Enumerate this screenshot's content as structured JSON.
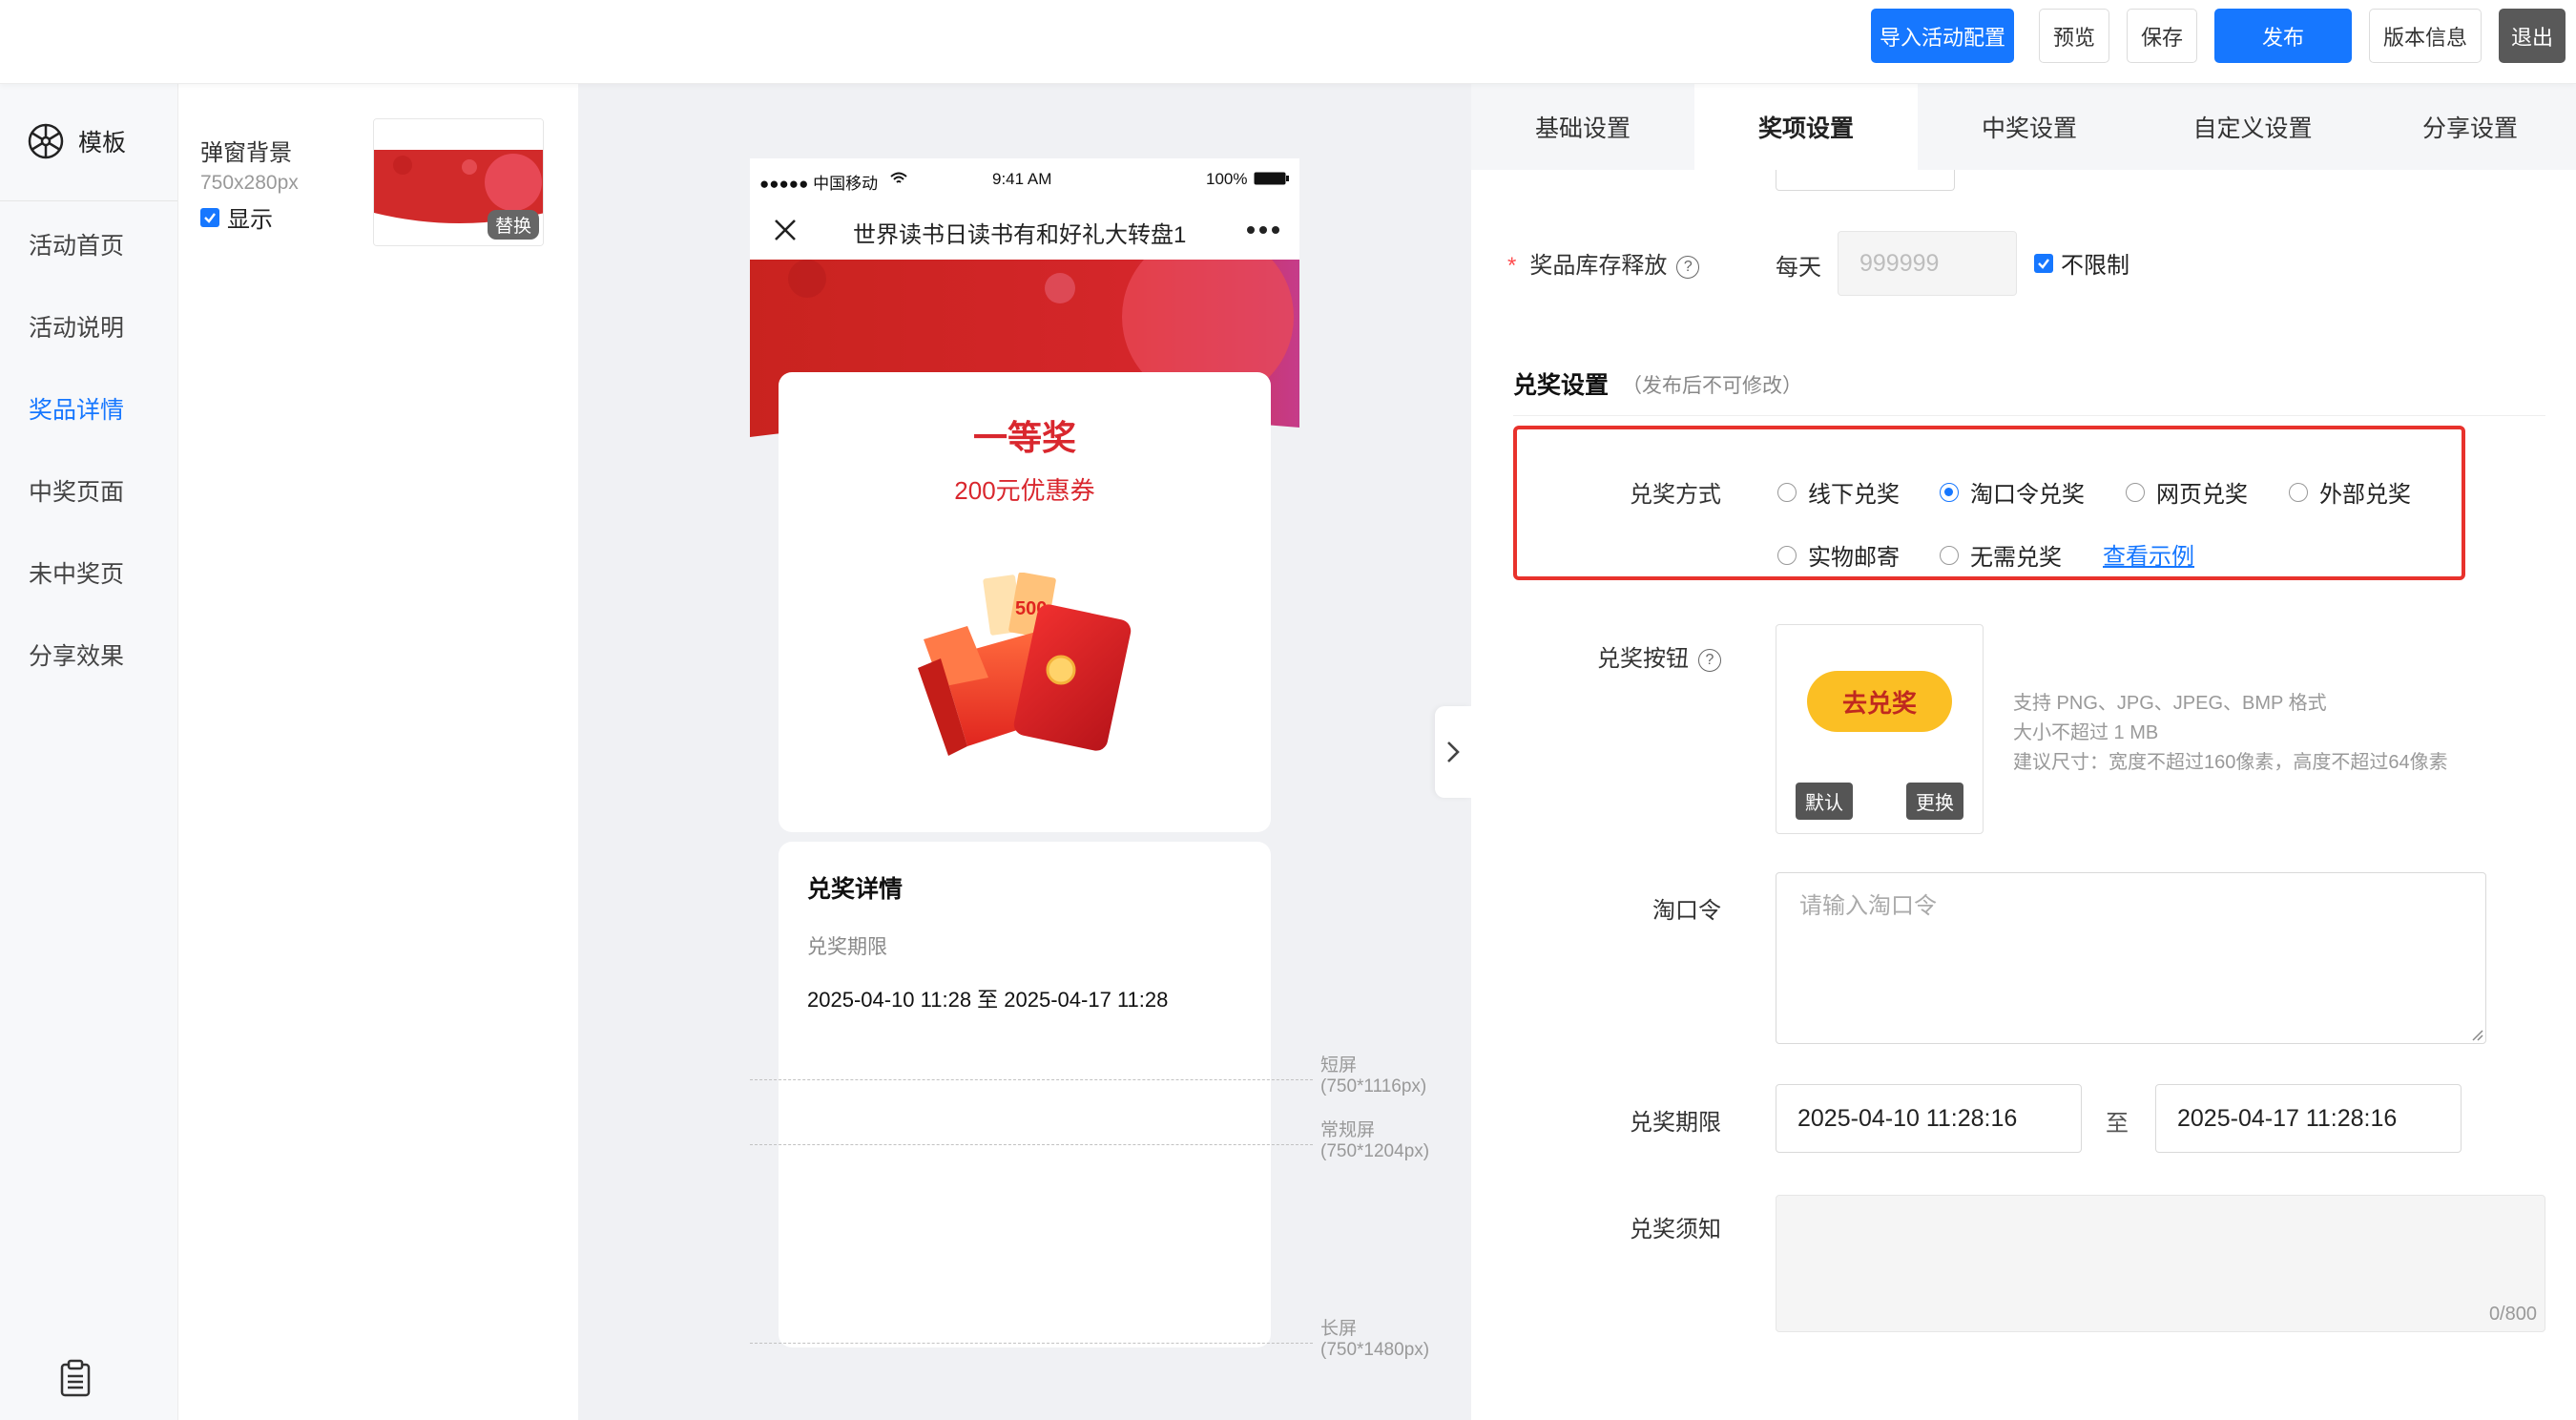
{
  "topbar": {
    "import_label": "导入活动配置",
    "preview_label": "预览",
    "save_label": "保存",
    "publish_label": "发布",
    "version_label": "版本信息",
    "exit_label": "退出"
  },
  "leftnav": {
    "logo_label": "模板",
    "items": [
      {
        "label": "活动首页",
        "active": false
      },
      {
        "label": "活动说明",
        "active": false
      },
      {
        "label": "奖品详情",
        "active": true
      },
      {
        "label": "中奖页面",
        "active": false
      },
      {
        "label": "未中奖页",
        "active": false
      },
      {
        "label": "分享效果",
        "active": false
      }
    ]
  },
  "module": {
    "bg_label": "弹窗背景",
    "bg_size": "750x280px",
    "show_label": "显示",
    "show_checked": true,
    "replace_label": "替换"
  },
  "phone": {
    "carrier": "●●●●● 中国移动",
    "time": "9:41 AM",
    "battery": "100%",
    "title": "世界读书日读书有和好礼大转盘1",
    "prize_name": "一等奖",
    "prize_desc": "200元优惠券",
    "coupon_text": "500",
    "detail_title": "兑奖详情",
    "detail_period_label": "兑奖期限",
    "detail_period_value": "2025-04-10 11:28 至 2025-04-17 11:28"
  },
  "guides": [
    {
      "name": "短屏",
      "size": "(750*1116px)"
    },
    {
      "name": "常规屏",
      "size": "(750*1204px)"
    },
    {
      "name": "长屏",
      "size": "(750*1480px)"
    }
  ],
  "settings": {
    "tabs": [
      "基础设置",
      "奖项设置",
      "中奖设置",
      "自定义设置",
      "分享设置"
    ],
    "active_tab": "奖项设置",
    "stock_label": "奖品库存释放",
    "stock_per_day": "每天",
    "stock_placeholder": "999999",
    "stock_unlimited_label": "不限制",
    "stock_unlimited_checked": true,
    "redeem_section_title": "兑奖设置",
    "redeem_section_note": "（发布后不可修改）",
    "redeem_method_label": "兑奖方式",
    "redeem_methods": [
      {
        "label": "线下兑奖",
        "selected": false
      },
      {
        "label": "淘口令兑奖",
        "selected": true
      },
      {
        "label": "网页兑奖",
        "selected": false
      },
      {
        "label": "外部兑奖",
        "selected": false
      },
      {
        "label": "实物邮寄",
        "selected": false
      },
      {
        "label": "无需兑奖",
        "selected": false
      }
    ],
    "view_example_label": "查看示例",
    "redeem_button_label": "兑奖按钮",
    "redeem_button_preview_text": "去兑奖",
    "upload_default_label": "默认",
    "upload_change_label": "更换",
    "upload_hints": [
      "支持 PNG、JPG、JPEG、BMP 格式",
      "大小不超过 1 MB",
      "建议尺寸：宽度不超过160像素，高度不超过64像素"
    ],
    "taokouling_label": "淘口令",
    "taokouling_placeholder": "请输入淘口令",
    "period_label": "兑奖期限",
    "period_start": "2025-04-10 11:28:16",
    "period_sep": "至",
    "period_end": "2025-04-17 11:28:16",
    "notice_label": "兑奖须知",
    "notice_counter": "0/800"
  },
  "colors": {
    "primary": "#1677ff",
    "danger": "#e8322c",
    "prize_red": "#d9272e",
    "button_yellow": "#fbbf24"
  }
}
